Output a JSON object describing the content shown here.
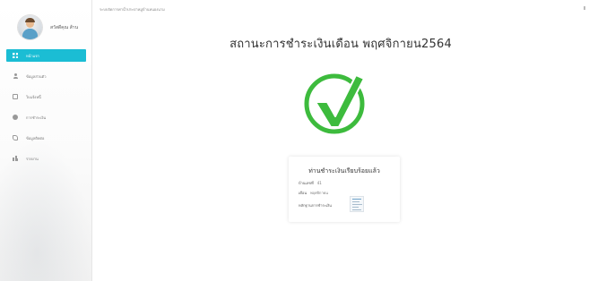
{
  "sidebar": {
    "user_name": "สวัสดีคุณ ส้าน",
    "items": [
      {
        "label": "หน้าแรก",
        "icon": "dashboard-icon",
        "active": true
      },
      {
        "label": "ข้อมูลส่วนตัว",
        "icon": "user-icon",
        "active": false
      },
      {
        "label": "ใบแจ้งหนี้",
        "icon": "document-icon",
        "active": false
      },
      {
        "label": "การชำระเงิน",
        "icon": "payment-icon",
        "active": false
      },
      {
        "label": "ข้อมูลติดต่อ",
        "icon": "phone-icon",
        "active": false
      },
      {
        "label": "รายงาน",
        "icon": "report-icon",
        "active": false
      }
    ]
  },
  "header": {
    "system_title": "ระบบจัดการค่าน้ำประปาหมู่บ้านหนองนาม"
  },
  "main": {
    "title": "สถานะการชำระเงินเดือน พฤศจิกายน2564",
    "status_icon": "checkmark-icon",
    "accent_color": "#3dbb3d"
  },
  "card": {
    "title": "ท่านชำระเงินเรียบร้อยแล้ว",
    "house_label": "บ้านเลขที่",
    "house_value": "41",
    "month_label": "เดือน",
    "month_value": "พฤศจิกายน",
    "proof_label": "หลักฐานการชำระเงิน",
    "proof_icon": "receipt-thumbnail-icon"
  }
}
